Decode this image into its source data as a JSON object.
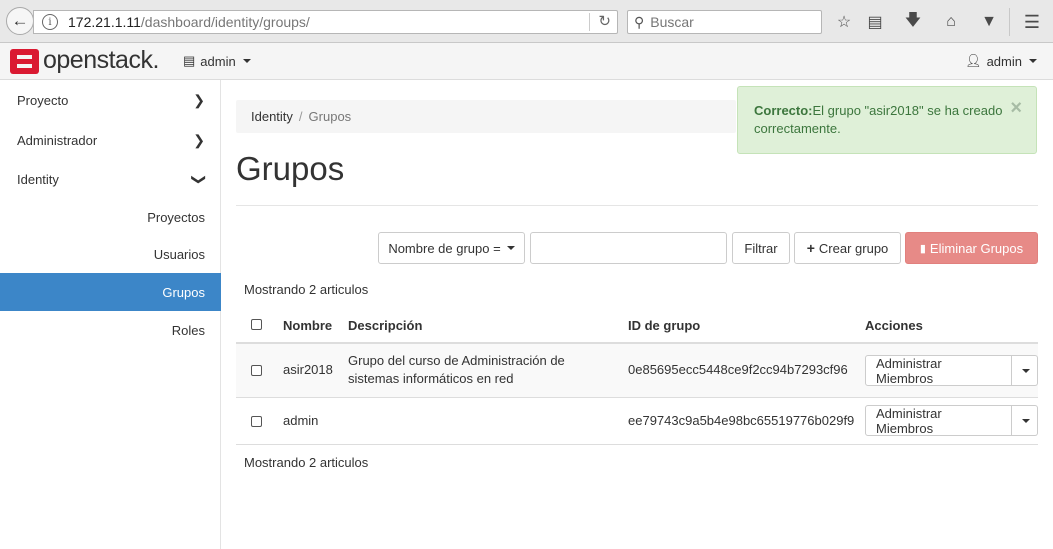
{
  "browser": {
    "url_host": "172.21.1.11",
    "url_path": "/dashboard/identity/groups/",
    "search_placeholder": "Buscar"
  },
  "header": {
    "logo_text": "openstack.",
    "project": "admin",
    "user": "admin"
  },
  "sidebar": {
    "categories": [
      {
        "label": "Proyecto"
      },
      {
        "label": "Administrador"
      },
      {
        "label": "Identity"
      }
    ],
    "items": [
      {
        "label": "Proyectos"
      },
      {
        "label": "Usuarios"
      },
      {
        "label": "Grupos",
        "active": true
      },
      {
        "label": "Roles"
      }
    ]
  },
  "breadcrumb": {
    "root": "Identity",
    "sep": "/",
    "current": "Grupos"
  },
  "page": {
    "title": "Grupos"
  },
  "alert": {
    "strong": "Correcto:",
    "message": "El grupo \"asir2018\" se ha creado correctamente.",
    "close": "×"
  },
  "toolbar": {
    "filter_field": "Nombre de grupo =",
    "filter_button": "Filtrar",
    "create_button": "Crear grupo",
    "delete_button": "Eliminar Grupos"
  },
  "table": {
    "count_top": "Mostrando 2 articulos",
    "count_bottom": "Mostrando 2 articulos",
    "headers": {
      "name": "Nombre",
      "description": "Descripción",
      "id": "ID de grupo",
      "actions": "Acciones"
    },
    "rows": [
      {
        "name": "asir2018",
        "description": "Grupo del curso de Administración de sistemas informáticos en red",
        "id": "0e85695ecc5448ce9f2cc94b7293cf96",
        "action": "Administrar Miembros"
      },
      {
        "name": "admin",
        "description": "",
        "id": "ee79743c9a5b4e98bc65519776b029f9",
        "action": "Administrar Miembros"
      }
    ]
  },
  "colors": {
    "sidebar_active": "#3c86c8",
    "alert_bg": "#dff0d8",
    "alert_text": "#3c763d",
    "danger_button": "#e78a87",
    "logo_red": "#da1a32"
  }
}
